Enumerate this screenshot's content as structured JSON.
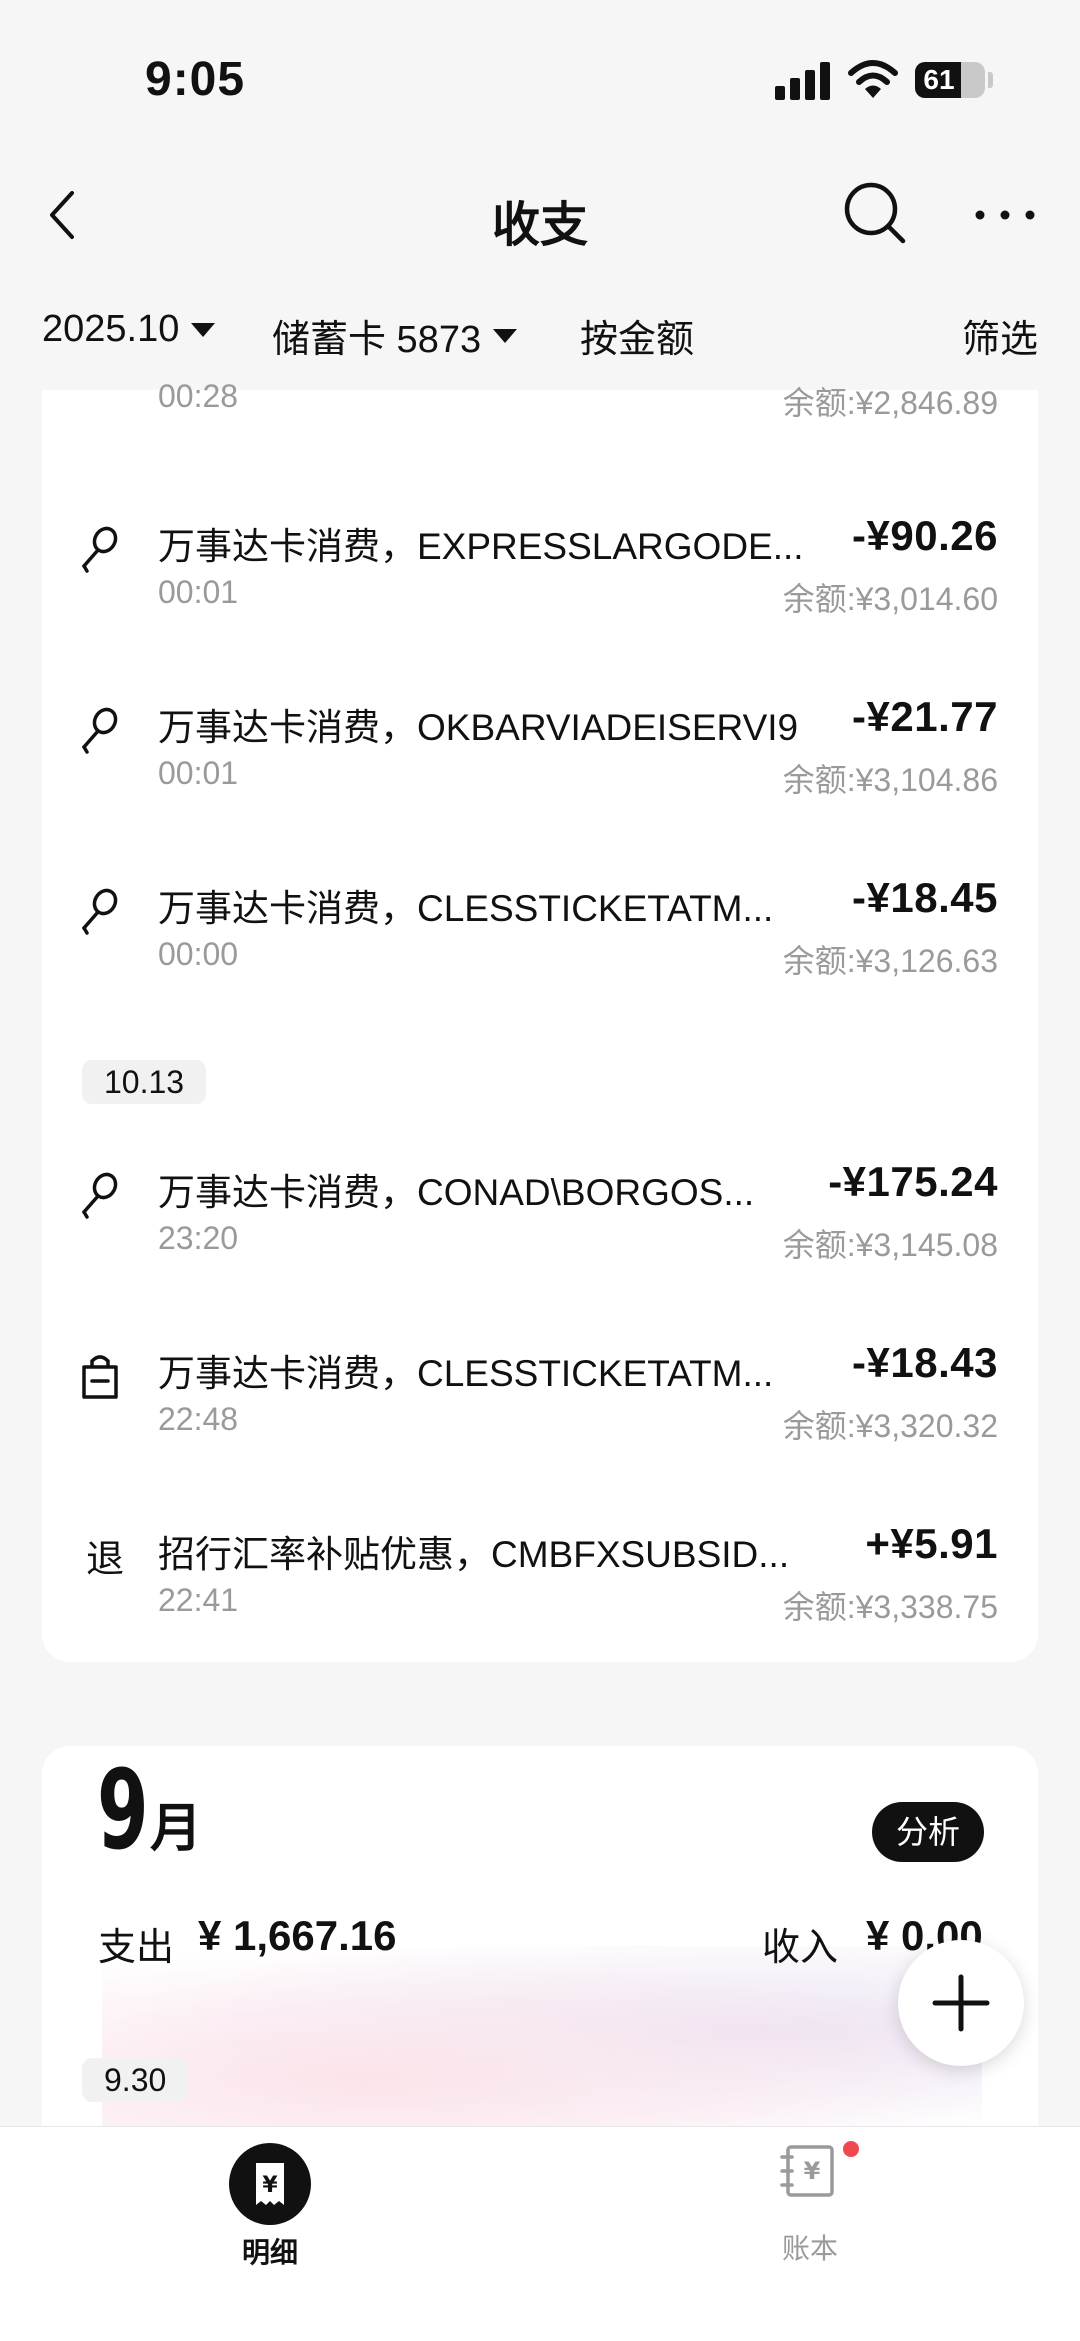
{
  "status_bar": {
    "time": "9:05",
    "battery": "61"
  },
  "nav": {
    "title": "收支"
  },
  "filters": {
    "period": "2025.10",
    "account": "储蓄卡 5873",
    "sort": "按金额",
    "filter": "筛选"
  },
  "top_partial": {
    "time": "00:28",
    "balance": "余额:¥2,846.89"
  },
  "transactions": [
    {
      "icon": "microphone-icon",
      "title": "万事达卡消费，EXPRESSLARGODE...",
      "amount": "-¥90.26",
      "time": "00:01",
      "balance": "余额:¥3,014.60"
    },
    {
      "icon": "microphone-icon",
      "title": "万事达卡消费，OKBARVIADEISERVI9",
      "amount": "-¥21.77",
      "time": "00:01",
      "balance": "余额:¥3,104.86"
    },
    {
      "icon": "microphone-icon",
      "title": "万事达卡消费，CLESSTICKETATM...",
      "amount": "-¥18.45",
      "time": "00:00",
      "balance": "余额:¥3,126.63"
    }
  ],
  "date_group": "10.13",
  "transactions_1013": [
    {
      "icon": "microphone-icon",
      "title": "万事达卡消费，CONAD\\BORGOS...",
      "amount": "-¥175.24",
      "time": "23:20",
      "balance": "余额:¥3,145.08"
    },
    {
      "icon": "shopping-bag-icon",
      "title": "万事达卡消费，CLESSTICKETATM...",
      "amount": "-¥18.43",
      "time": "22:48",
      "balance": "余额:¥3,320.32"
    },
    {
      "icon_text": "退",
      "title": "招行汇率补贴优惠，CMBFXSUBSID...",
      "amount": "+¥5.91",
      "time": "22:41",
      "balance": "余额:¥3,338.75"
    }
  ],
  "month_summary": {
    "month_number": "9",
    "month_unit": "月",
    "analysis_label": "分析",
    "expense_label": "支出",
    "expense_value": "¥ 1,667.16",
    "income_label": "收入",
    "income_value": "¥ 0.00",
    "first_date": "9.30"
  },
  "tab_bar": {
    "detail_label": "明细",
    "ledger_label": "账本"
  }
}
